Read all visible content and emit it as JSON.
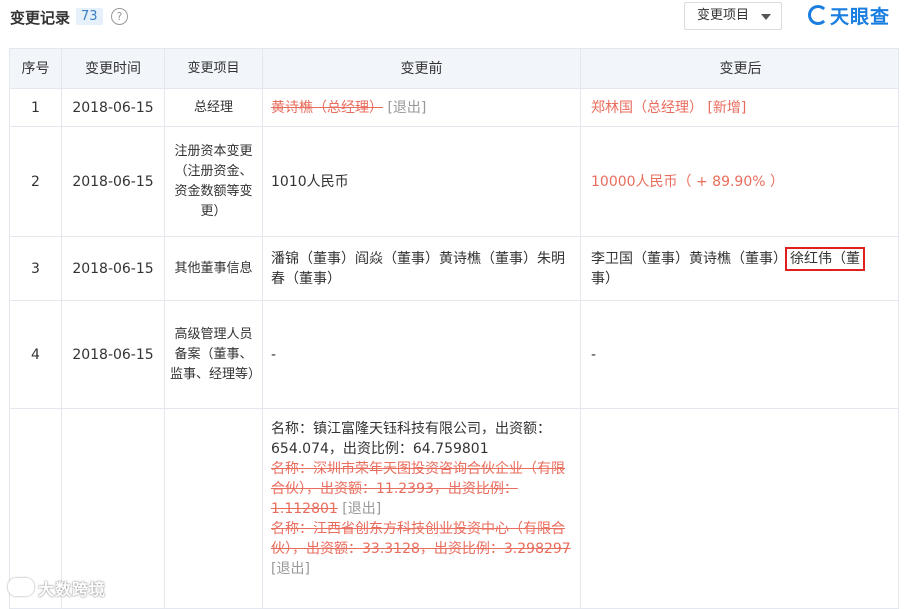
{
  "header": {
    "title": "变更记录",
    "count": "73",
    "help_glyph": "?",
    "filter_label": "变更项目",
    "brand": "天眼查"
  },
  "columns": [
    "序号",
    "变更时间",
    "变更项目",
    "变更前",
    "变更后"
  ],
  "rows": [
    {
      "num": "1",
      "date": "2018-06-15",
      "item": "总经理",
      "before_removed": "黄诗樵（总经理）",
      "before_tag": "[退出]",
      "after_text": "郑林国（总经理）",
      "after_tag": "[新增]"
    },
    {
      "num": "2",
      "date": "2018-06-15",
      "item": "注册资本变更（注册资金、资金数额等变更）",
      "before": "1010人民币",
      "after": "10000人民币（ + 89.90% ）"
    },
    {
      "num": "3",
      "date": "2018-06-15",
      "item": "其他董事信息",
      "before": "潘锦（董事）阎焱（董事）黄诗樵（董事）朱明春（董事）",
      "after_start": "李卫国（董事）黄诗樵（董事）",
      "after_highlight": "徐红伟（董",
      "after_end": "事）"
    },
    {
      "num": "4",
      "date": "2018-06-15",
      "item": "高级管理人员备案（董事、监事、经理等）",
      "before": "-",
      "after": "-"
    },
    {
      "num": "",
      "date": "",
      "item": "",
      "before_line1": "名称：镇江富隆天钰科技有限公司，出资额：654.074，出资比例：64.759801",
      "before_removed2": "名称：深圳市荣年天图投资咨询合伙企业（有限合伙），出资额：11.2393，出资比例：1.112801",
      "before_tag2": "[退出]",
      "before_removed3": "名称：江西省创东方科技创业投资中心（有限合伙），出资额：33.3128，出资比例：3.298297",
      "before_tag3": "[退出]",
      "after": ""
    }
  ],
  "watermark": "大数跨境"
}
